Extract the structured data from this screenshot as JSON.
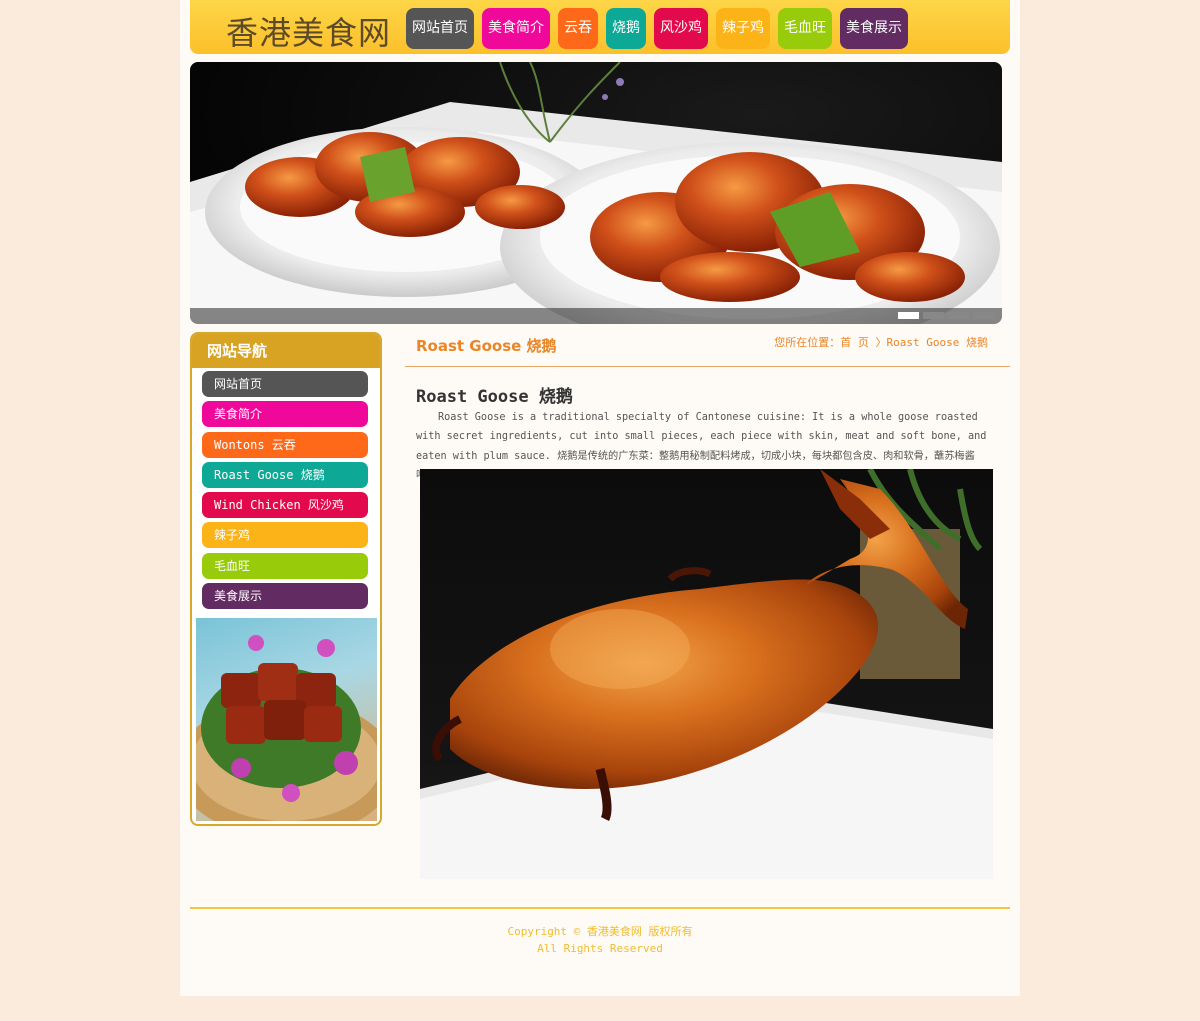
{
  "header": {
    "logo": "香港美食网",
    "nav": [
      {
        "label": "网站首页",
        "color": "#555555"
      },
      {
        "label": "美食简介",
        "color": "#f0089a"
      },
      {
        "label": "云吞",
        "color": "#fd6819"
      },
      {
        "label": "烧鹅",
        "color": "#0ea996"
      },
      {
        "label": "风沙鸡",
        "color": "#e2094c"
      },
      {
        "label": "辣子鸡",
        "color": "#fcb317"
      },
      {
        "label": "毛血旺",
        "color": "#98cb0a"
      },
      {
        "label": "美食展示",
        "color": "#622c62"
      }
    ]
  },
  "banner": {
    "slides": 4,
    "active_slide": 1
  },
  "sidebar": {
    "title": "网站导航",
    "items": [
      {
        "label": "网站首页",
        "color": "#555555"
      },
      {
        "label": "美食简介",
        "color": "#f0089a"
      },
      {
        "label": "Wontons 云吞",
        "color": "#fd6819"
      },
      {
        "label": "Roast Goose 烧鹅",
        "color": "#0ea996"
      },
      {
        "label": "Wind Chicken 风沙鸡",
        "color": "#e2094c"
      },
      {
        "label": "辣子鸡",
        "color": "#fcb317"
      },
      {
        "label": "毛血旺",
        "color": "#98cb0a"
      },
      {
        "label": "美食展示",
        "color": "#622c62"
      }
    ]
  },
  "main": {
    "section_title": "Roast Goose 烧鹅",
    "breadcrumb": "您所在位置：首 页 〉Roast Goose 烧鹅",
    "article_title": "Roast Goose 烧鹅",
    "article_text": "Roast Goose is a traditional specialty of Cantonese cuisine: It is a whole goose roasted with secret ingredients, cut into small pieces, each piece with skin, meat and soft bone, and eaten with plum sauce. 烧鹅是传统的广东菜：整鹅用秘制配料烤成，切成小块，每块都包含皮、肉和软骨，蘸苏梅酱吃。"
  },
  "footer": {
    "line1": "Copyright © 香港美食网 版权所有",
    "line2": "All Rights Reserved"
  },
  "colors": {
    "accent": "#e8862a",
    "header_bg": "#fcc02a",
    "sidebar_title": "#d8a222",
    "footer_text": "#f0bd2c"
  }
}
